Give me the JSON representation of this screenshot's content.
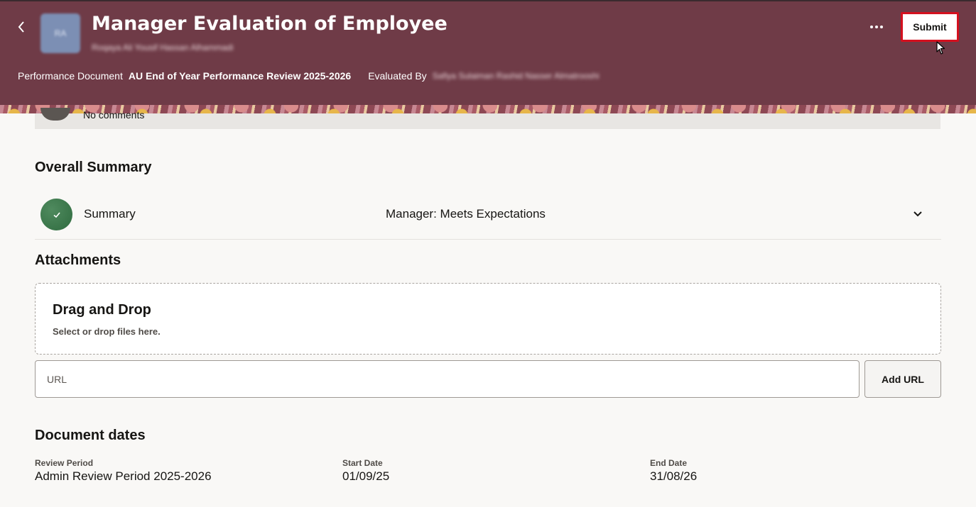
{
  "header": {
    "title": "Manager Evaluation of Employee",
    "employee_name": "Roqaya Ali Yousif Hassan Alhammadi",
    "avatar_initials": "RA",
    "meta": [
      {
        "label": "Performance Document",
        "value": "AU End of Year Performance Review 2025-2026"
      },
      {
        "label": "Evaluated By",
        "value": "Safiya Sulaiman Rashid Nasser Almatrooshi"
      }
    ],
    "submit_label": "Submit"
  },
  "comments": {
    "text": "No comments"
  },
  "overall_summary": {
    "title": "Overall Summary",
    "row_label": "Summary",
    "row_value": "Manager: Meets Expectations"
  },
  "attachments": {
    "title": "Attachments",
    "drop_title": "Drag and Drop",
    "drop_subtitle": "Select or drop files here.",
    "url_placeholder": "URL",
    "add_url_label": "Add URL"
  },
  "document_dates": {
    "title": "Document dates",
    "fields": [
      {
        "label": "Review Period",
        "value": "Admin Review Period 2025-2026"
      },
      {
        "label": "Start Date",
        "value": "01/09/25"
      },
      {
        "label": "End Date",
        "value": "31/08/26"
      }
    ]
  },
  "colors": {
    "header_bg": "#6f3b47",
    "submit_border": "#d4101f",
    "summary_icon": "#2f6b3f"
  },
  "icons": [
    "chevron-left-icon",
    "more-dots-icon",
    "check-icon",
    "chevron-down-icon",
    "mouse-cursor-icon"
  ]
}
